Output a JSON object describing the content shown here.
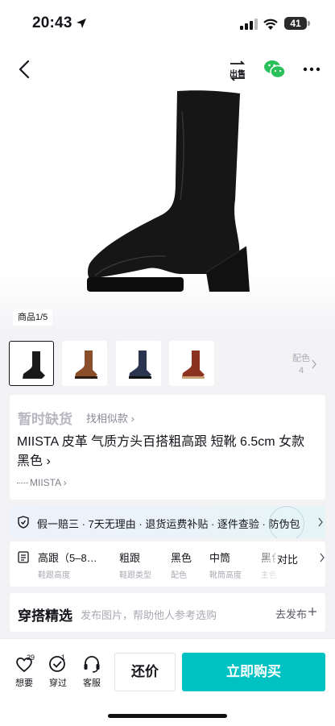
{
  "status_bar": {
    "time": "20:43",
    "battery": "41"
  },
  "header": {
    "sell_label": "出售"
  },
  "gallery": {
    "indicator": "商品1/5",
    "colors_label": "配色",
    "colors_count": "4"
  },
  "product": {
    "stock_status": "暂时缺货",
    "find_similar": "找相似款 ›",
    "title": "MIISTA 皮革 气质方头百搭粗高跟 短靴 6.5cm 女款 黑色 ›",
    "brand": "MIISTA ›"
  },
  "guarantee": {
    "text": "假一赔三 · 7天无理由 · 退货运费补贴 · 逐件查验 · 防伪包"
  },
  "params": {
    "items": [
      {
        "value": "高跟（5–8…",
        "key": "鞋跟高度"
      },
      {
        "value": "粗跟",
        "key": "鞋跟类型"
      },
      {
        "value": "黑色",
        "key": "配色"
      },
      {
        "value": "中筒",
        "key": "靴筒高度"
      },
      {
        "value": "黑色",
        "key": "主色"
      }
    ],
    "compare_label": "对比"
  },
  "outfit": {
    "title": "穿搭精选",
    "subtitle": "发布图片，帮助他人参考选购",
    "post_label": "去发布"
  },
  "bottom_bar": {
    "want_label": "想要",
    "want_count": "29",
    "bought_label": "穿过",
    "bought_count": "1",
    "service_label": "客服",
    "offer_label": "还价",
    "buy_label": "立即购买"
  },
  "colors": {
    "buy_button": "#01c2c3",
    "thumb_brown": "#8a4e2a",
    "thumb_navy": "#2c3550",
    "thumb_rust": "#8a3320"
  }
}
